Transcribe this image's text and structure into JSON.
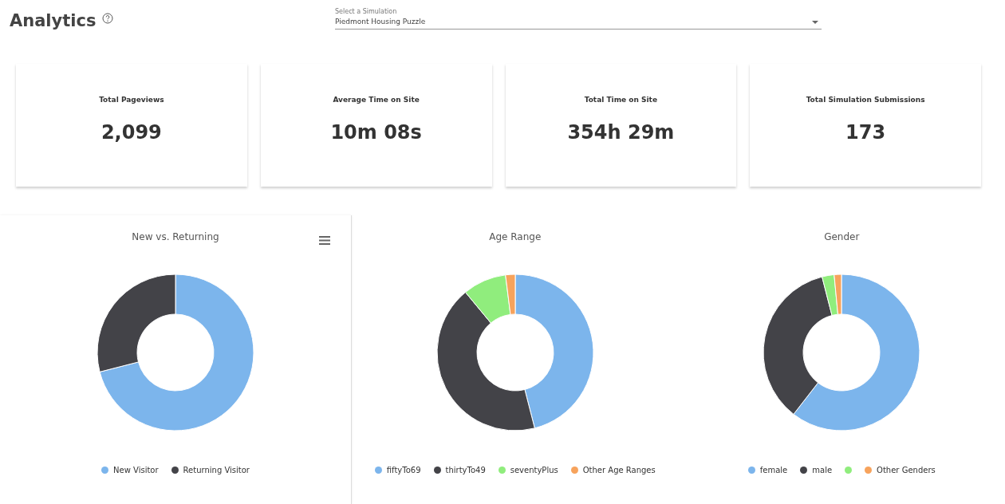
{
  "header": {
    "title": "Analytics",
    "simulator_select": {
      "label": "Select a Simulation",
      "value": "Piedmont Housing Puzzle"
    }
  },
  "stats": [
    {
      "label": "Total Pageviews",
      "value": "2,099"
    },
    {
      "label": "Average Time on Site",
      "value": "10m 08s"
    },
    {
      "label": "Total Time on Site",
      "value": "354h 29m"
    },
    {
      "label": "Total Simulation Submissions",
      "value": "173"
    }
  ],
  "charts": [
    {
      "title": "New vs. Returning",
      "menu": true,
      "legend": [
        {
          "label": "New Visitor",
          "color": "#7cb5ec"
        },
        {
          "label": "Returning Visitor",
          "color": "#434348"
        }
      ]
    },
    {
      "title": "Age Range",
      "menu": false,
      "legend": [
        {
          "label": "fiftyTo69",
          "color": "#7cb5ec"
        },
        {
          "label": "thirtyTo49",
          "color": "#434348"
        },
        {
          "label": "seventyPlus",
          "color": "#90ed7d"
        },
        {
          "label": "Other Age Ranges",
          "color": "#f7a35c"
        }
      ]
    },
    {
      "title": "Gender",
      "menu": false,
      "legend": [
        {
          "label": "female",
          "color": "#7cb5ec"
        },
        {
          "label": "male",
          "color": "#434348"
        },
        {
          "color": "#90ed7d"
        },
        {
          "label": "Other Genders",
          "color": "#f7a35c"
        }
      ]
    }
  ]
}
